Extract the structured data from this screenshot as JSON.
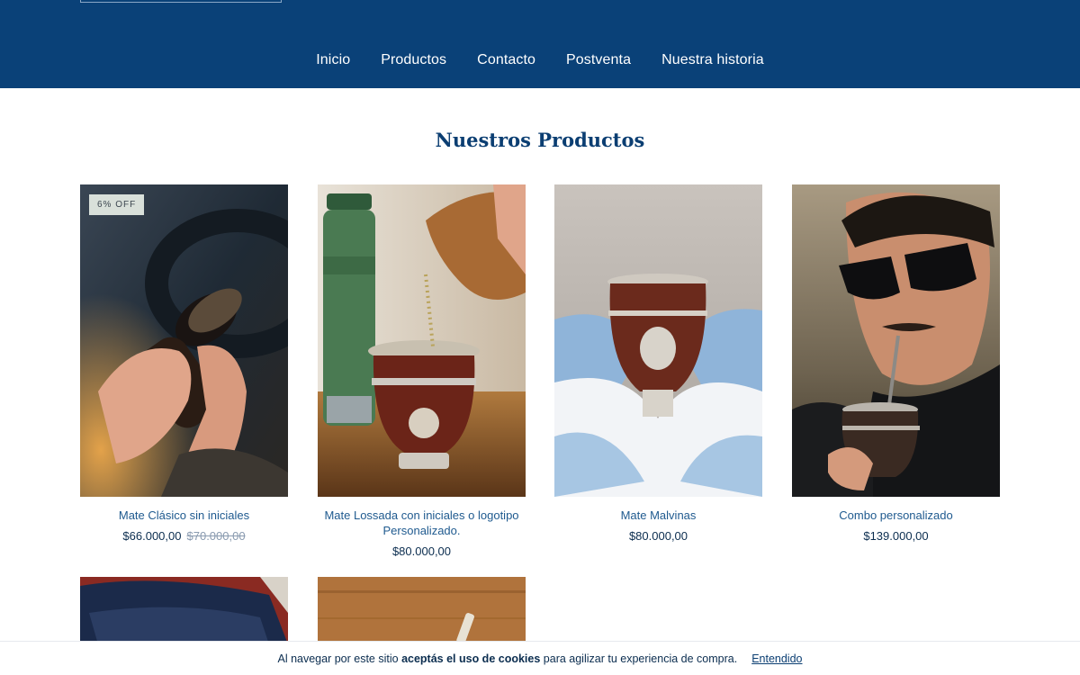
{
  "nav": {
    "items": [
      "Inicio",
      "Productos",
      "Contacto",
      "Postventa",
      "Nuestra historia"
    ]
  },
  "section": {
    "title": "Nuestros Productos"
  },
  "products": [
    {
      "name": "Mate Clásico sin iniciales",
      "price": "$66.000,00",
      "old_price": "$70.000,00",
      "badge": "6% OFF"
    },
    {
      "name": "Mate Lossada con iniciales o logotipo Personalizado.",
      "price": "$80.000,00"
    },
    {
      "name": "Mate Malvinas",
      "price": "$80.000,00"
    },
    {
      "name": "Combo personalizado",
      "price": "$139.000,00"
    }
  ],
  "cookie": {
    "prefix": "Al navegar por este sitio ",
    "bold": "aceptás el uso de cookies",
    "suffix": " para agilizar tu experiencia de compra.",
    "button": "Entendido"
  },
  "colors": {
    "header_bg": "#0a4178",
    "text_primary": "#0b3e72"
  }
}
